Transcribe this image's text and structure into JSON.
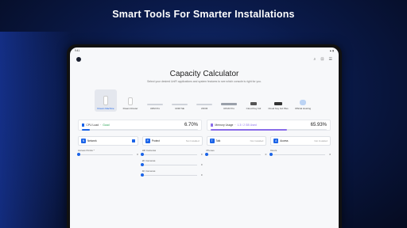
{
  "headline": "Smart Tools For Smarter Installations",
  "app": {
    "title": "Capacity Calculator",
    "subtitle": "Select your desired UniFi applications and system features to see which console is right for you."
  },
  "devices": [
    {
      "label": "Dream Machine",
      "selected": true
    },
    {
      "label": "Dream Router",
      "selected": false
    },
    {
      "label": "UDM Pro",
      "selected": false
    },
    {
      "label": "UDM SE",
      "selected": false
    },
    {
      "label": "UNVR",
      "selected": false
    },
    {
      "label": "UNVR Pro",
      "selected": false
    },
    {
      "label": "Cloud Key G2",
      "selected": false
    },
    {
      "label": "Cloud Key G2 Plus",
      "selected": false
    },
    {
      "label": "Official Hosting",
      "selected": false
    }
  ],
  "cpu": {
    "label": "CPU Load",
    "status": "Good",
    "percent": "6.70%",
    "fill": 0.067,
    "color": "#1a63e8"
  },
  "memory": {
    "label": "Memory Usage",
    "detail": "1.3 / 2 GB Used",
    "percent": "65.93%",
    "fill": 0.6593,
    "color": "#8a6de9"
  },
  "apps": [
    {
      "name": "Network",
      "state": "",
      "checked": true,
      "icon": "network-icon",
      "fields": [
        {
          "label": "Access Points *",
          "value": "0"
        }
      ]
    },
    {
      "name": "Protect",
      "state": "Not Installed",
      "checked": false,
      "icon": "protect-icon",
      "fields": [
        {
          "label": "HD Cameras",
          "value": "0"
        },
        {
          "label": "2K Cameras",
          "value": "0"
        },
        {
          "label": "4K Cameras",
          "value": "0"
        }
      ]
    },
    {
      "name": "Talk",
      "state": "Not Installed",
      "checked": false,
      "icon": "talk-icon",
      "fields": [
        {
          "label": "Phones",
          "value": "0"
        }
      ]
    },
    {
      "name": "Access",
      "state": "Not Installed",
      "checked": false,
      "icon": "access-icon",
      "fields": [
        {
          "label": "Doors",
          "value": "0"
        }
      ]
    }
  ]
}
